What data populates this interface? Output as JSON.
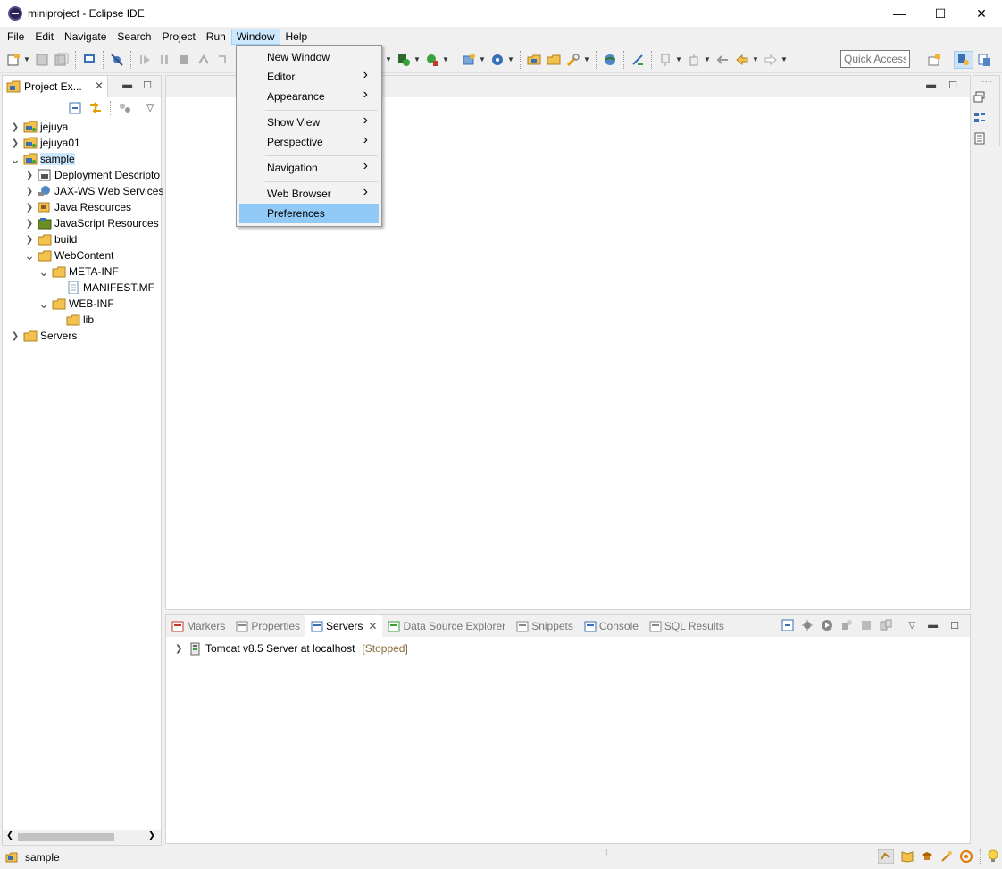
{
  "window": {
    "title": "miniproject - Eclipse IDE",
    "controls": {
      "minimize": "—",
      "maximize": "☐",
      "close": "✕"
    }
  },
  "menubar": [
    "File",
    "Edit",
    "Navigate",
    "Search",
    "Project",
    "Run",
    "Window",
    "Help"
  ],
  "window_menu": {
    "items": [
      {
        "label": "New Window",
        "submenu": false
      },
      {
        "label": "Editor",
        "submenu": true
      },
      {
        "label": "Appearance",
        "submenu": true
      },
      {
        "label": "Show View",
        "submenu": true
      },
      {
        "label": "Perspective",
        "submenu": true
      },
      {
        "label": "Navigation",
        "submenu": true
      },
      {
        "label": "Web Browser",
        "submenu": true
      },
      {
        "label": "Preferences",
        "submenu": false,
        "highlighted": true
      }
    ]
  },
  "toolbar": {
    "quick_access_placeholder": "Quick Access"
  },
  "project_explorer": {
    "tab_label": "Project Ex...",
    "tree": [
      {
        "label": "jejuya",
        "depth": 0,
        "expanded": false,
        "icon": "project-icon"
      },
      {
        "label": "jejuya01",
        "depth": 0,
        "expanded": false,
        "icon": "project-icon"
      },
      {
        "label": "sample",
        "depth": 0,
        "expanded": true,
        "icon": "project-icon",
        "selected": true
      },
      {
        "label": "Deployment Descripto",
        "depth": 1,
        "expanded": false,
        "icon": "deployment-descriptor-icon"
      },
      {
        "label": "JAX-WS Web Services",
        "depth": 1,
        "expanded": false,
        "icon": "web-services-icon"
      },
      {
        "label": "Java Resources",
        "depth": 1,
        "expanded": false,
        "icon": "java-resources-icon"
      },
      {
        "label": "JavaScript Resources",
        "depth": 1,
        "expanded": false,
        "icon": "javascript-resources-icon"
      },
      {
        "label": "build",
        "depth": 1,
        "expanded": false,
        "icon": "folder-icon"
      },
      {
        "label": "WebContent",
        "depth": 1,
        "expanded": true,
        "icon": "folder-icon"
      },
      {
        "label": "META-INF",
        "depth": 2,
        "expanded": true,
        "icon": "folder-icon"
      },
      {
        "label": "MANIFEST.MF",
        "depth": 3,
        "expanded": null,
        "icon": "file-icon"
      },
      {
        "label": "WEB-INF",
        "depth": 2,
        "expanded": true,
        "icon": "folder-icon"
      },
      {
        "label": "lib",
        "depth": 3,
        "expanded": null,
        "icon": "folder-icon"
      },
      {
        "label": "Servers",
        "depth": 0,
        "expanded": false,
        "icon": "folder-icon"
      }
    ]
  },
  "bottom_panel": {
    "tabs": [
      {
        "label": "Markers",
        "active": false,
        "icon": "markers-icon"
      },
      {
        "label": "Properties",
        "active": false,
        "icon": "properties-icon"
      },
      {
        "label": "Servers",
        "active": true,
        "icon": "servers-icon"
      },
      {
        "label": "Data Source Explorer",
        "active": false,
        "icon": "data-source-icon"
      },
      {
        "label": "Snippets",
        "active": false,
        "icon": "snippets-icon"
      },
      {
        "label": "Console",
        "active": false,
        "icon": "console-icon"
      },
      {
        "label": "SQL Results",
        "active": false,
        "icon": "sql-results-icon"
      }
    ],
    "servers": [
      {
        "name": "Tomcat v8.5 Server at localhost",
        "status": "[Stopped]"
      }
    ]
  },
  "statusbar": {
    "selection": "sample"
  },
  "colors": {
    "menu_highlight": "#91c9f7",
    "selection": "#cce8ff",
    "status_stopped": "#8a6d3b"
  }
}
